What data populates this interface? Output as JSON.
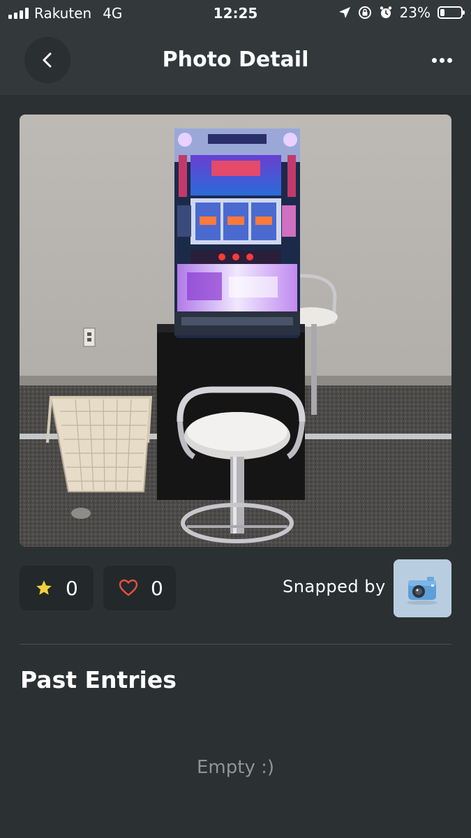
{
  "status_bar": {
    "carrier": "Rakuten",
    "network": "4G",
    "time": "12:25",
    "battery_percent": "23%",
    "battery_level": 0.23
  },
  "nav": {
    "title": "Photo Detail",
    "back_icon": "chevron-left-icon",
    "more_icon": "more-horizontal-icon"
  },
  "photo": {
    "subject": "pachislot machine on black pedestal with stool",
    "colors": {
      "wall": "#b9b6b1",
      "carpet": "#4d4b4a"
    }
  },
  "actions": {
    "star_count": "0",
    "heart_count": "0",
    "star_color": "#f2d23b",
    "heart_color": "#e2533f"
  },
  "snapped_by": {
    "label": "Snapped by",
    "avatar_icon": "camera-icon"
  },
  "past_entries": {
    "title": "Past Entries",
    "empty_text": "Empty :)"
  }
}
